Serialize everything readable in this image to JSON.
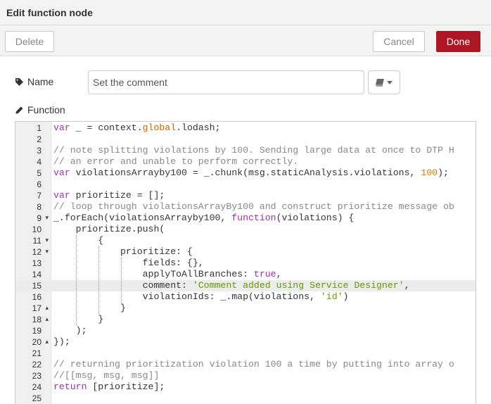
{
  "dialog": {
    "title": "Edit function node"
  },
  "buttons": {
    "delete": "Delete",
    "cancel": "Cancel",
    "done": "Done"
  },
  "colors": {
    "done_bg": "#ad1625",
    "toolbar_bg": "#f3f3f3"
  },
  "form": {
    "name_label": "Name",
    "name_value": "Set the comment",
    "name_icon": "tag-icon",
    "function_label": "Function",
    "function_icon": "pencil-icon",
    "icon_button_icon": "book-icon"
  },
  "editor": {
    "active_line": 15,
    "lines": [
      {
        "n": "1",
        "fold": "",
        "text": "var _ = context.global.lodash;"
      },
      {
        "n": "2",
        "fold": "",
        "text": ""
      },
      {
        "n": "3",
        "fold": "",
        "text": "// note splitting violations by 100. Sending large data at once to DTP H"
      },
      {
        "n": "4",
        "fold": "",
        "text": "// an error and unable to perform correctly."
      },
      {
        "n": "5",
        "fold": "",
        "text": "var violationsArrayby100 = _.chunk(msg.staticAnalysis.violations, 100);"
      },
      {
        "n": "6",
        "fold": "",
        "text": ""
      },
      {
        "n": "7",
        "fold": "",
        "text": "var prioritize = [];"
      },
      {
        "n": "8",
        "fold": "",
        "text": "// loop through violationsArrayBy100 and construct prioritize message ob"
      },
      {
        "n": "9",
        "fold": "▾",
        "text": "_.forEach(violationsArrayby100, function(violations) {"
      },
      {
        "n": "10",
        "fold": "",
        "text": "    prioritize.push("
      },
      {
        "n": "11",
        "fold": "▾",
        "text": "        {"
      },
      {
        "n": "12",
        "fold": "▾",
        "text": "            prioritize: {"
      },
      {
        "n": "13",
        "fold": "",
        "text": "                fields: {},"
      },
      {
        "n": "14",
        "fold": "",
        "text": "                applyToAllBranches: true,"
      },
      {
        "n": "15",
        "fold": "",
        "text": "                comment: 'Comment added using Service Designer',"
      },
      {
        "n": "16",
        "fold": "",
        "text": "                violationIds: _.map(violations, 'id')"
      },
      {
        "n": "17",
        "fold": "▴",
        "text": "            }"
      },
      {
        "n": "18",
        "fold": "▴",
        "text": "        }"
      },
      {
        "n": "19",
        "fold": "",
        "text": "    );"
      },
      {
        "n": "20",
        "fold": "▴",
        "text": "});"
      },
      {
        "n": "21",
        "fold": "",
        "text": ""
      },
      {
        "n": "22",
        "fold": "",
        "text": "// returning prioritization violation 100 a time by putting into array o"
      },
      {
        "n": "23",
        "fold": "",
        "text": "//[[msg, msg, msg]]"
      },
      {
        "n": "24",
        "fold": "",
        "text": "return [prioritize];"
      },
      {
        "n": "25",
        "fold": "",
        "text": ""
      }
    ]
  }
}
